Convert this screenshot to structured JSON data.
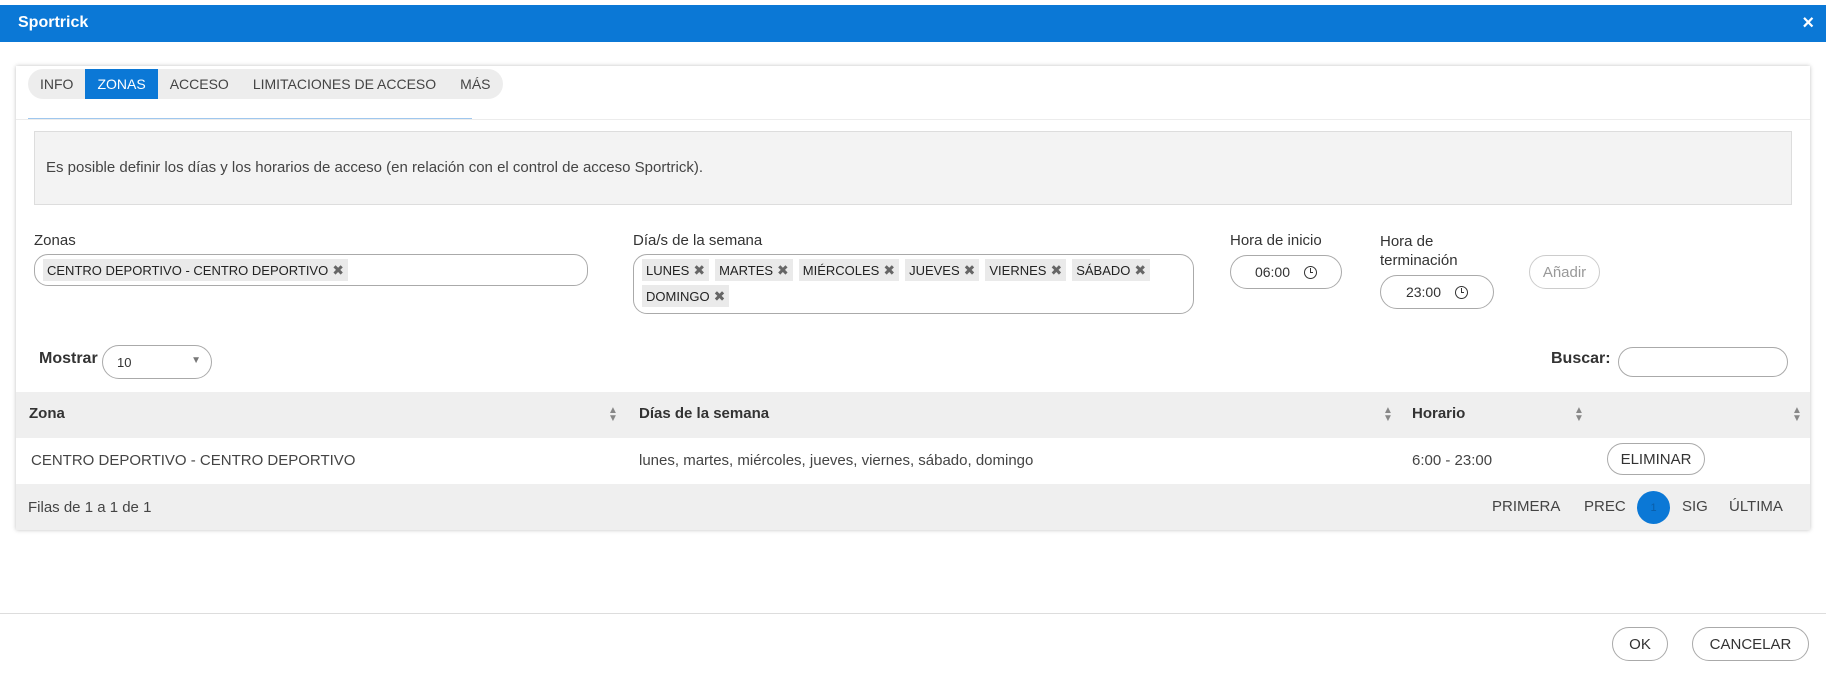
{
  "window": {
    "title": "Sportrick",
    "close_glyph": "×"
  },
  "tabs": [
    {
      "label": "INFO",
      "active": false
    },
    {
      "label": "ZONAS",
      "active": true
    },
    {
      "label": "ACCESO",
      "active": false
    },
    {
      "label": "LIMITACIONES DE ACCESO",
      "active": false
    },
    {
      "label": "MÁS",
      "active": false
    }
  ],
  "info_text": "Es posible definir los días y los horarios de acceso (en relación con el control de acceso Sportrick).",
  "form": {
    "zonas_label": "Zonas",
    "zonas_chips": [
      "CENTRO DEPORTIVO - CENTRO DEPORTIVO"
    ],
    "dias_label": "Día/s de la semana",
    "dias_chips": [
      "LUNES",
      "MARTES",
      "MIÉRCOLES",
      "JUEVES",
      "VIERNES",
      "SÁBADO",
      "DOMINGO"
    ],
    "hora_inicio_label": "Hora de inicio",
    "hora_inicio_value": "06:00",
    "hora_fin_label_line1": "Hora de",
    "hora_fin_label_line2": "terminación",
    "hora_fin_value": "23:00",
    "add_label": "Añadir",
    "chip_remove_glyph": "✖"
  },
  "table_controls": {
    "mostrar_label": "Mostrar",
    "mostrar_value": "10",
    "buscar_label": "Buscar:",
    "buscar_value": ""
  },
  "table": {
    "headers": [
      "Zona",
      "Días de la semana",
      "Horario",
      ""
    ],
    "rows": [
      {
        "zona": "CENTRO DEPORTIVO - CENTRO DEPORTIVO",
        "dias": "lunes, martes, miércoles, jueves, viernes, sábado, domingo",
        "horario": "6:00 - 23:00",
        "action": "ELIMINAR"
      }
    ]
  },
  "pagination": {
    "info": "Filas de 1 a 1 de 1",
    "first": "PRIMERA",
    "prev": "PREC",
    "current": "1",
    "next": "SIG",
    "last": "ÚLTIMA"
  },
  "footer": {
    "ok": "OK",
    "cancel": "CANCELAR"
  },
  "colors": {
    "accent": "#0b78d6"
  }
}
